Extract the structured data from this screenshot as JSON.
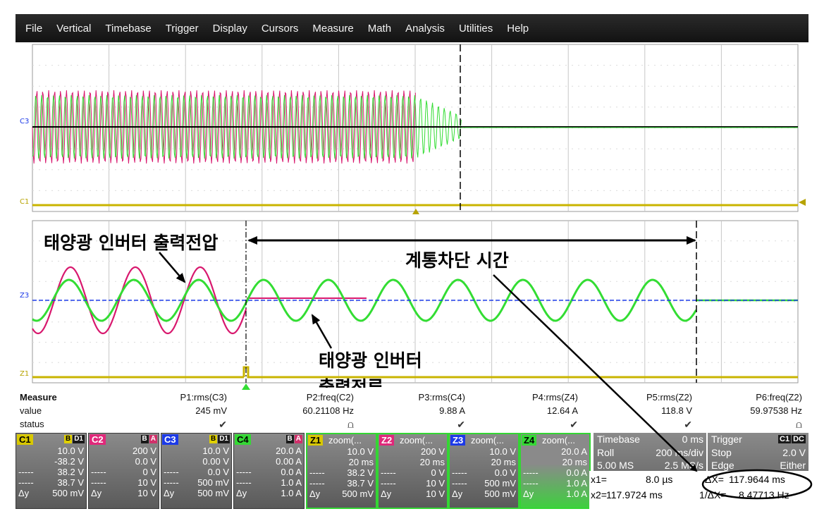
{
  "menu": [
    "File",
    "Vertical",
    "Timebase",
    "Trigger",
    "Display",
    "Cursors",
    "Measure",
    "Math",
    "Analysis",
    "Utilities",
    "Help"
  ],
  "top_grid": {
    "label_c3": "C3",
    "label_c1": "C1"
  },
  "zoom_grid": {
    "label_z3": "Z3",
    "label_z1": "Z1"
  },
  "annotations": {
    "inverter_output_voltage": "태양광 인버터 출력전압",
    "inverter_output_current_visible": "태양광 인버터",
    "inverter_output_current_clipped": "출력전류",
    "grid_disconnect_time": "계통차단 시간"
  },
  "measure": {
    "headers": {
      "row_title": "Measure",
      "value_label": "value",
      "status_label": "status"
    },
    "params": [
      {
        "name": "P1:rms(C3)",
        "value": "245 mV",
        "status": "✔"
      },
      {
        "name": "P2:freq(C2)",
        "value": "60.21108 Hz",
        "status": "⩍"
      },
      {
        "name": "P3:rms(C4)",
        "value": "9.88 A",
        "status": "✔"
      },
      {
        "name": "P4:rms(Z4)",
        "value": "12.64 A",
        "status": "✔"
      },
      {
        "name": "P5:rms(Z2)",
        "value": "118.8 V",
        "status": "✔"
      },
      {
        "name": "P6:freq(Z2)",
        "value": "59.97538 Hz",
        "status": "⩍"
      }
    ]
  },
  "channels": [
    {
      "tag": "C1",
      "badge": [
        "B",
        "D1"
      ],
      "tag_color": "#d8c800",
      "scale": "10.0 V",
      "offset": "-38.2 V",
      "l3": [
        "-----",
        "38.2 V"
      ],
      "l4": [
        "-----",
        "38.7 V"
      ],
      "l5": [
        "Δy",
        "500 mV"
      ]
    },
    {
      "tag": "C2",
      "badge": [
        "B",
        "A"
      ],
      "tag_color": "#e0287a",
      "scale": "200 V",
      "offset": "0.0 V",
      "l3": [
        "-----",
        "0 V"
      ],
      "l4": [
        "-----",
        "10 V"
      ],
      "l5": [
        "Δy",
        "10 V"
      ]
    },
    {
      "tag": "C3",
      "badge": [
        "B",
        "D1"
      ],
      "tag_color": "#1c3ae8",
      "scale": "10.0 V",
      "offset": "0.00 V",
      "l3": [
        "-----",
        "0.0 V"
      ],
      "l4": [
        "-----",
        "500 mV"
      ],
      "l5": [
        "Δy",
        "500 mV"
      ]
    },
    {
      "tag": "C4",
      "badge": [
        "B",
        "A"
      ],
      "tag_color": "#35d835",
      "scale": "20.0 A",
      "offset": "0.00 A",
      "l3": [
        "-----",
        "0.0 A"
      ],
      "l4": [
        "-----",
        "1.0 A"
      ],
      "l5": [
        "Δy",
        "1.0 A"
      ]
    },
    {
      "tag": "Z1",
      "title": "zoom(...",
      "badge": [],
      "tag_color": "#d8c800",
      "scale": "10.0 V",
      "offset": "20 ms",
      "l3": [
        "-----",
        "38.2 V"
      ],
      "l4": [
        "-----",
        "38.7 V"
      ],
      "l5": [
        "Δy",
        "500 mV"
      ]
    },
    {
      "tag": "Z2",
      "title": "zoom(...",
      "badge": [],
      "tag_color": "#e0287a",
      "scale": "200 V",
      "offset": "20 ms",
      "l3": [
        "-----",
        "0 V"
      ],
      "l4": [
        "-----",
        "10 V"
      ],
      "l5": [
        "Δy",
        "10 V"
      ]
    },
    {
      "tag": "Z3",
      "title": "zoom(...",
      "badge": [],
      "tag_color": "#1c3ae8",
      "scale": "10.0 V",
      "offset": "20 ms",
      "l3": [
        "-----",
        "0.0 V"
      ],
      "l4": [
        "-----",
        "500 mV"
      ],
      "l5": [
        "Δy",
        "500 mV"
      ]
    },
    {
      "tag": "Z4",
      "title": "zoom(...",
      "badge": [],
      "tag_color": "#35d835",
      "scale": "20.0 A",
      "offset": "20 ms",
      "l3": [
        "-----",
        "0.0 A"
      ],
      "l4": [
        "-----",
        "1.0 A"
      ],
      "l5": [
        "Δy",
        "1.0 A"
      ]
    }
  ],
  "timebase": {
    "title": "Timebase",
    "title_val": "0 ms",
    "mode": "Roll",
    "mode_val": "200 ms/div",
    "samples": "5.00 MS",
    "rate": "2.5 MS/s"
  },
  "trigger": {
    "title": "Trigger",
    "badge": [
      "C1",
      "DC"
    ],
    "mode": "Stop",
    "level": "2.0 V",
    "type": "Edge",
    "slope": "Either"
  },
  "cursors": {
    "x1_label": "x1=",
    "x1_val": "8.0 µs",
    "dx_label": "ΔX=",
    "dx_val": "117.9644 ms",
    "x2_label": "x2=",
    "x2_val": "117.9724 ms",
    "inv_label": "1/ΔX=",
    "inv_val": "8.47713 Hz"
  },
  "colors": {
    "ch1_yellow": "#c9b400",
    "ch2_magenta": "#d8186e",
    "ch3_blue": "#1c3ae8",
    "ch4_green": "#33dd33",
    "grid": "#9a9a9a"
  }
}
